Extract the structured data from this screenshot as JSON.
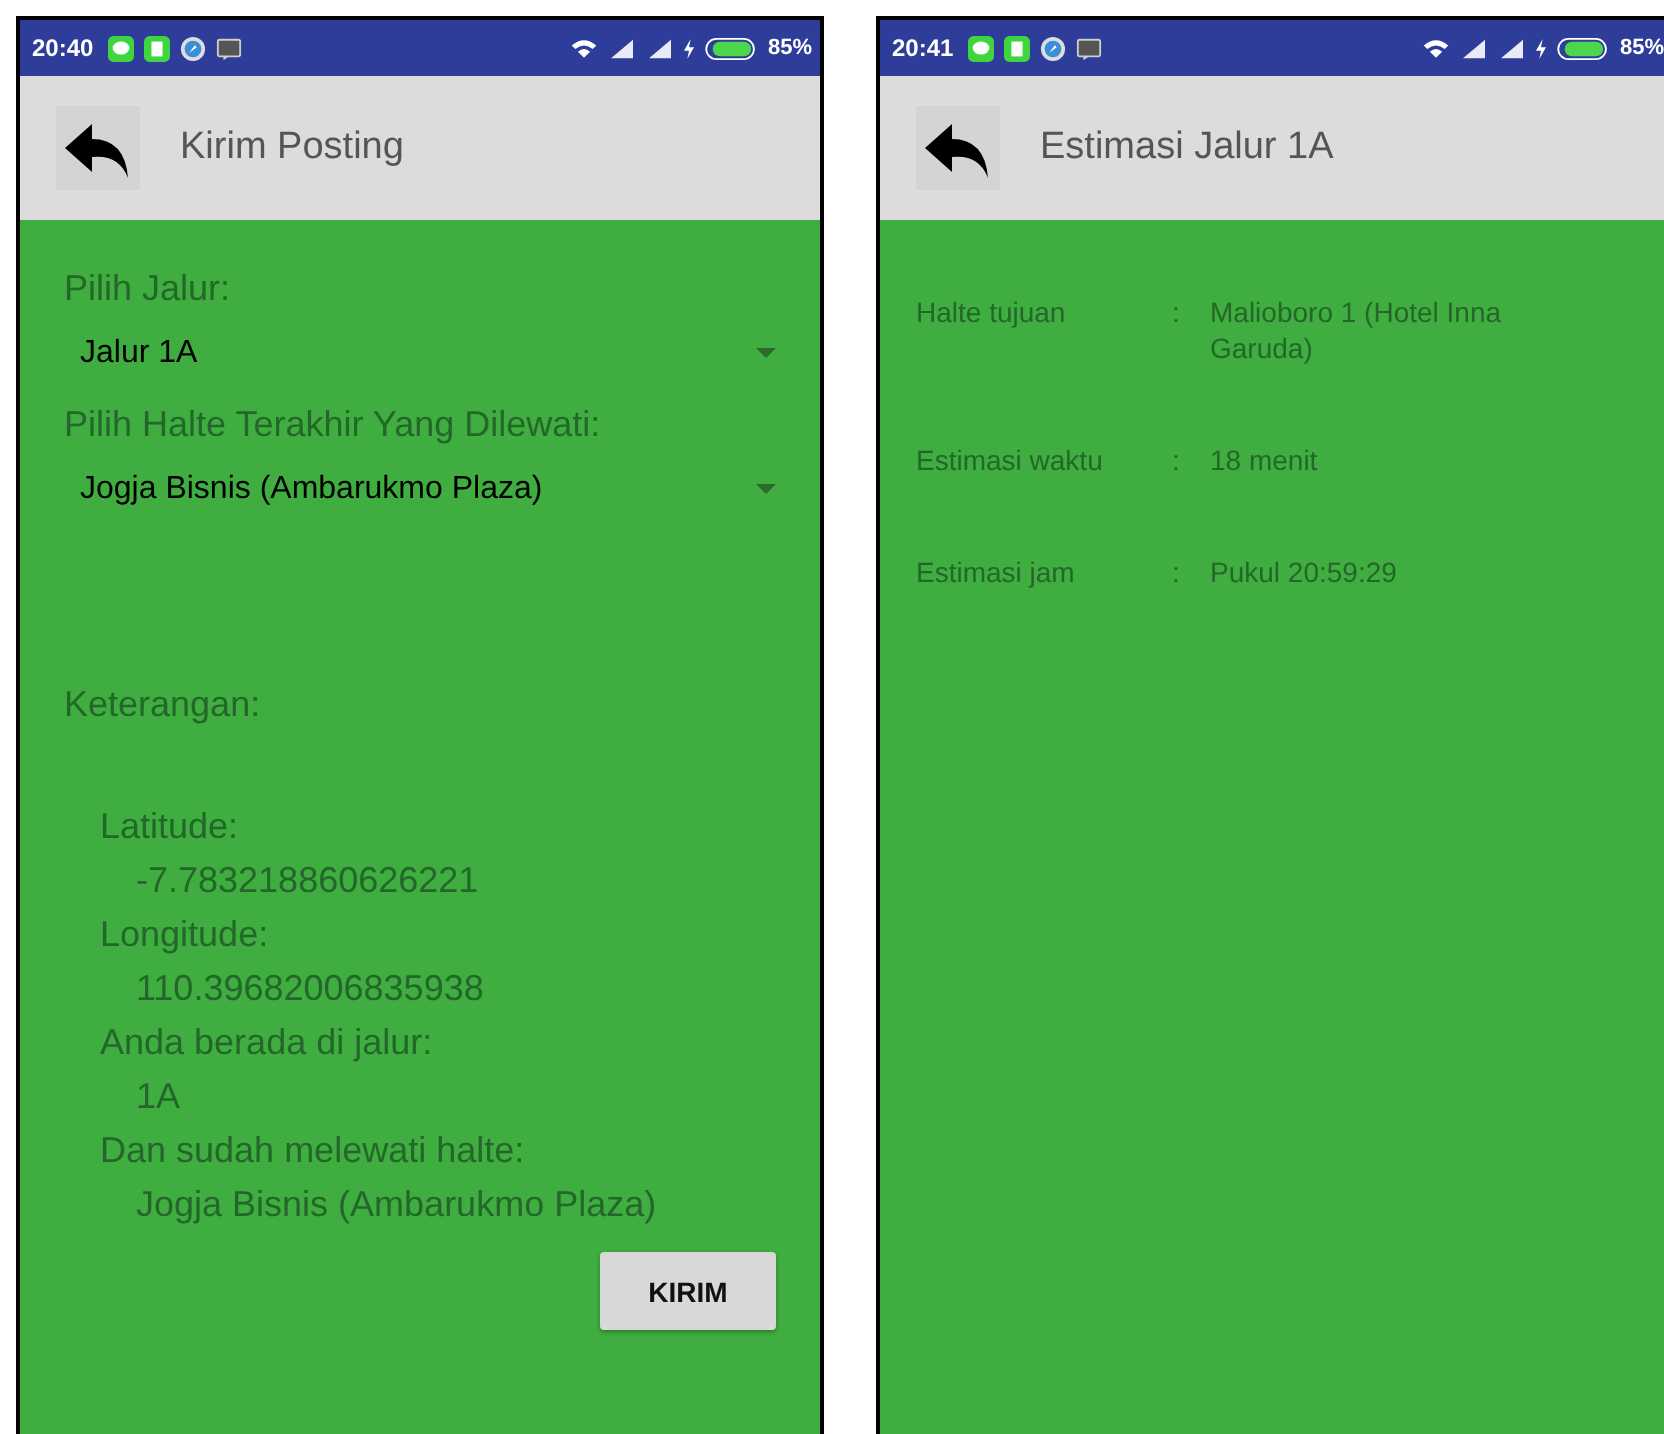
{
  "screens": [
    {
      "status_bar": {
        "time": "20:40",
        "battery": "85%"
      },
      "app_bar": {
        "title": "Kirim Posting"
      },
      "kind": "form",
      "fields": [
        {
          "label": "Pilih Jalur:",
          "value": "Jalur 1A"
        },
        {
          "label": "Pilih Halte Terakhir Yang Dilewati:",
          "value": "Jogja Bisnis (Ambarukmo Plaza)"
        }
      ],
      "info": {
        "heading": "Keterangan:",
        "items": [
          {
            "label": "Latitude:",
            "value": "-7.783218860626221"
          },
          {
            "label": "Longitude:",
            "value": "110.39682006835938"
          },
          {
            "label": "Anda berada di jalur:",
            "value": "1A"
          },
          {
            "label": "Dan sudah melewati halte:",
            "value": "Jogja Bisnis (Ambarukmo Plaza)"
          }
        ]
      },
      "button": "KIRIM"
    },
    {
      "status_bar": {
        "time": "20:41",
        "battery": "85%"
      },
      "app_bar": {
        "title": "Estimasi Jalur 1A"
      },
      "kind": "details",
      "rows": [
        {
          "label": "Halte tujuan",
          "separator": ":",
          "value": "Malioboro 1 (Hotel Inna Garuda)"
        },
        {
          "label": "Estimasi waktu",
          "separator": ":",
          "value": "18 menit"
        },
        {
          "label": "Estimasi jam",
          "separator": ":",
          "value": "Pukul 20:59:29"
        }
      ]
    }
  ]
}
